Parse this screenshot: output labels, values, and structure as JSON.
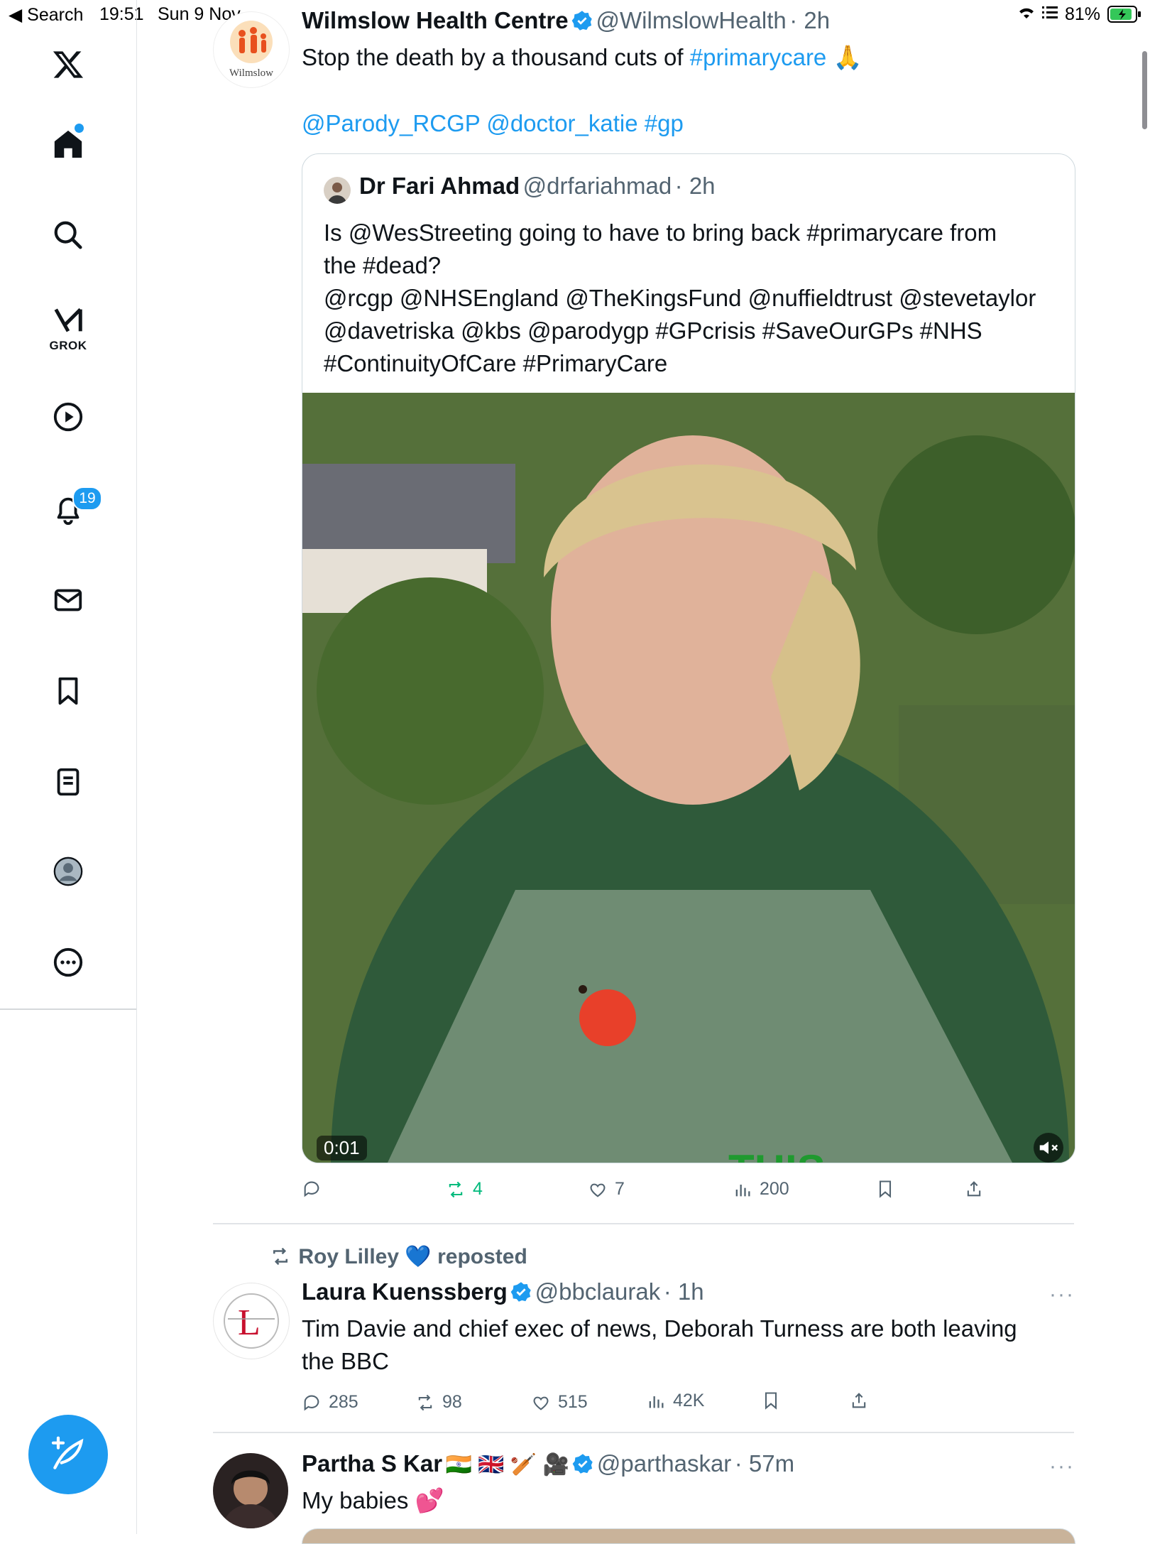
{
  "status_bar": {
    "back_label": "◀ Search",
    "time": "19:51",
    "date": "Sun 9 Nov",
    "battery": "81%"
  },
  "sidebar": {
    "grok_label": "GROK",
    "notifications_count": "19"
  },
  "tweets": [
    {
      "name": "Wilmslow Health Centre",
      "handle": "@WilmslowHealth",
      "time": "· 2h",
      "avatar_text": "Wilmslow",
      "text_plain": "Stop the death by a thousand cuts of ",
      "text_link": "#primarycare",
      "text_emoji": "🙏",
      "mentions": "@Parody_RCGP @doctor_katie #gp",
      "quote": {
        "name": "Dr Fari Ahmad",
        "handle": "@drfariahmad",
        "time": "· 2h",
        "lines": [
          "Is @WesStreeting going to have to bring back #primarycare from",
          "the #dead?",
          "@rcgp @NHSEngland @TheKingsFund @nuffieldtrust @stevetaylor",
          "@davetriska @kbs @parodygp  #GPcrisis #SaveOurGPs #NHS",
          "#ContinuityOfCare #PrimaryCare"
        ],
        "video_time": "0:01",
        "caption_fragment": "THIS"
      },
      "metrics": {
        "reply": "",
        "retweet": "4",
        "like": "7",
        "views": "200"
      }
    },
    {
      "repost_by": "Roy Lilley",
      "repost_emoji": "💙",
      "repost_word": "reposted",
      "name": "Laura Kuenssberg",
      "handle": "@bbclaurak",
      "time": "· 1h",
      "more": "···",
      "lines": [
        "Tim Davie and chief exec of news, Deborah Turness are both leaving",
        "the BBC"
      ],
      "metrics": {
        "reply": "285",
        "retweet": "98",
        "like": "515",
        "views": "42K"
      }
    },
    {
      "name": "Partha S Kar",
      "name_emojis": "🇮🇳 🇬🇧 🏏 🎥",
      "handle": "@parthaskar",
      "time": "· 57m",
      "more": "···",
      "text": "My babies",
      "text_emoji": "💕"
    }
  ],
  "colors": {
    "accent": "#1d9bf0",
    "retweet_green": "#00ba7c",
    "muted": "#536471"
  },
  "icons": [
    "x-logo-icon",
    "home-icon",
    "search-icon",
    "grok-icon",
    "video-play-icon",
    "bell-icon",
    "mail-icon",
    "bookmark-icon",
    "list-icon",
    "profile-icon",
    "more-circle-icon",
    "compose-icon"
  ]
}
